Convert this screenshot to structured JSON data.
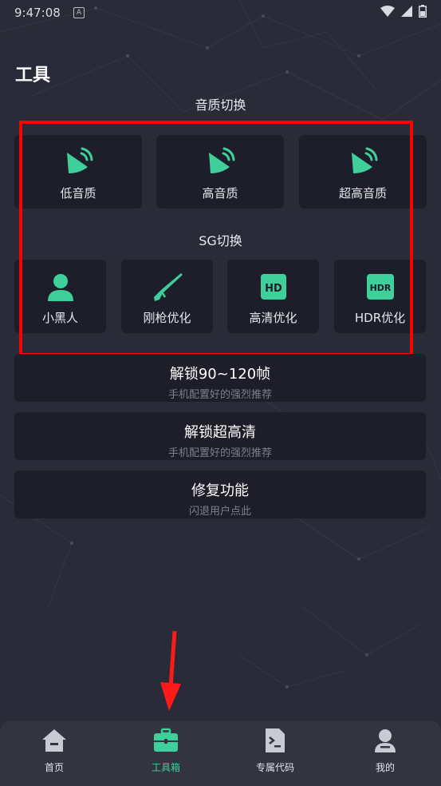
{
  "status_bar": {
    "time": "9:47:08",
    "notification_glyph": "A"
  },
  "page": {
    "title": "工具"
  },
  "sections": {
    "audio": {
      "label": "音质切换",
      "items": [
        {
          "label": "低音质",
          "icon": "speaker-icon"
        },
        {
          "label": "高音质",
          "icon": "speaker-icon"
        },
        {
          "label": "超高音质",
          "icon": "speaker-icon"
        }
      ]
    },
    "sg": {
      "label": "SG切换",
      "items": [
        {
          "label": "小黑人",
          "icon": "person-icon"
        },
        {
          "label": "刚枪优化",
          "icon": "rifle-icon"
        },
        {
          "label": "高清优化",
          "icon": "hd-icon"
        },
        {
          "label": "HDR优化",
          "icon": "hdr-icon"
        }
      ]
    }
  },
  "icon_text": {
    "hd": "HD",
    "hdr": "HDR"
  },
  "cards": [
    {
      "title": "解锁90~120帧",
      "subtitle": "手机配置好的强烈推荐"
    },
    {
      "title": "解锁超高清",
      "subtitle": "手机配置好的强烈推荐"
    },
    {
      "title": "修复功能",
      "subtitle": "闪退用户点此"
    }
  ],
  "bottom_nav": {
    "items": [
      {
        "label": "首页",
        "icon": "home-icon",
        "active": false
      },
      {
        "label": "工具箱",
        "icon": "toolbox-icon",
        "active": true
      },
      {
        "label": "专属代码",
        "icon": "code-file-icon",
        "active": false
      },
      {
        "label": "我的",
        "icon": "profile-icon",
        "active": false
      }
    ]
  },
  "colors": {
    "background": "#2a2b38",
    "tile": "#1d1e2a",
    "accent": "#3ecf9b",
    "nav_bar": "#33343f",
    "annotation": "#ff0000"
  }
}
